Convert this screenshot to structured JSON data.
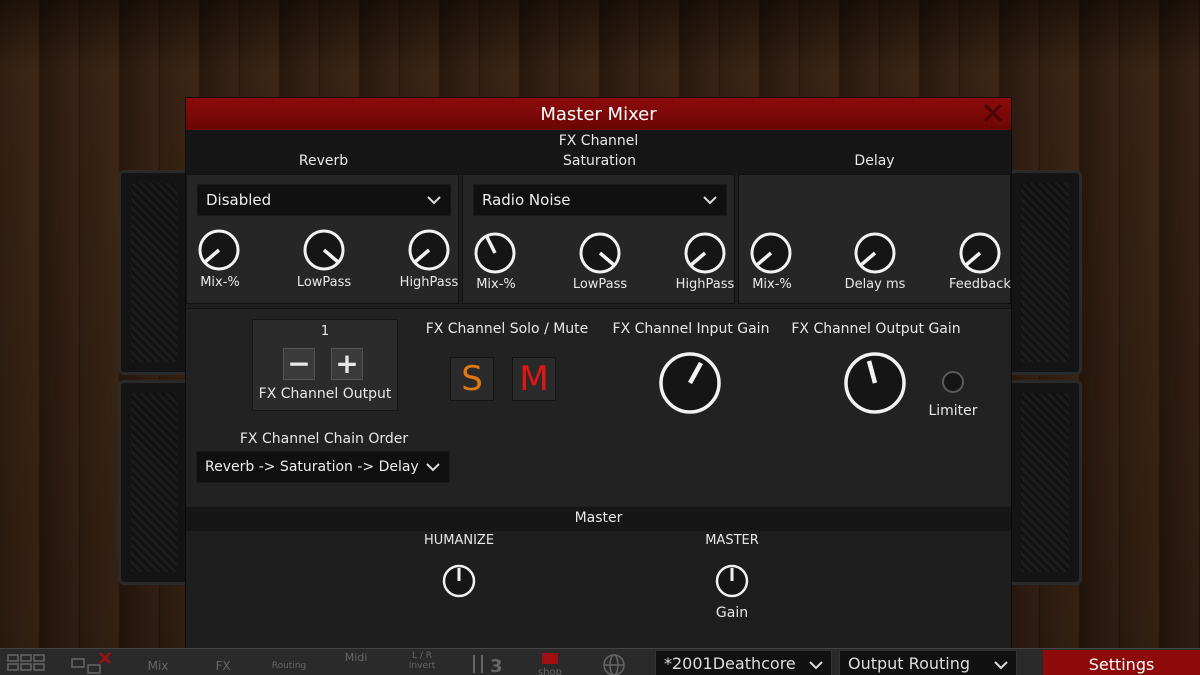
{
  "modal": {
    "title": "Master Mixer",
    "fx_channel_label": "FX Channel",
    "columns": [
      "Reverb",
      "Saturation",
      "Delay"
    ],
    "reverb": {
      "preset": "Disabled",
      "knobs": [
        "Mix-%",
        "LowPass",
        "HighPass"
      ]
    },
    "saturation": {
      "preset": "Radio Noise",
      "knobs": [
        "Mix-%",
        "LowPass",
        "HighPass"
      ]
    },
    "delay": {
      "knobs": [
        "Mix-%",
        "Delay ms",
        "Feedback"
      ]
    },
    "output": {
      "value": "1",
      "label": "FX Channel Output",
      "minus": "−",
      "plus": "+"
    },
    "chain": {
      "label": "FX Channel Chain Order",
      "value": "Reverb -> Saturation -> Delay"
    },
    "solo_mute": {
      "label": "FX Channel Solo / Mute",
      "solo": "S",
      "mute": "M"
    },
    "input_gain": {
      "label": "FX Channel Input Gain"
    },
    "output_gain": {
      "label": "FX Channel Output Gain"
    },
    "limiter": {
      "label": "Limiter"
    },
    "master": {
      "section": "Master",
      "humanize": "HUMANIZE",
      "master_label": "MASTER",
      "gain": "Gain"
    }
  },
  "toolbar": {
    "icons": [
      "Mix",
      "FX",
      "Routing",
      "Midi",
      "L / R Invert",
      "shop"
    ],
    "preset": "*2001Deathcore",
    "routing": "Output Routing",
    "settings": "Settings"
  },
  "colors": {
    "accent": "#8e0b0b",
    "solo": "#e07a10",
    "mute": "#e01515"
  }
}
